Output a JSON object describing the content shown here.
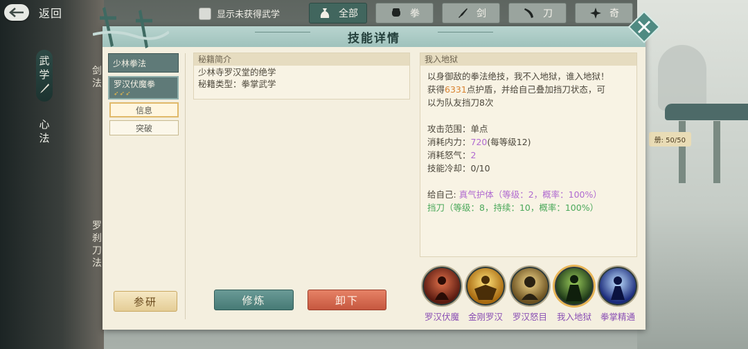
{
  "topbar": {
    "back_label": "返回",
    "show_unlearned_label": "显示未获得武学",
    "tabs": [
      {
        "label": "全部",
        "icon": "pouch-icon",
        "active": true
      },
      {
        "label": "拳",
        "icon": "fist-icon",
        "active": false
      },
      {
        "label": "剑",
        "icon": "sword-icon",
        "active": false
      },
      {
        "label": "刀",
        "icon": "blade-icon",
        "active": false
      },
      {
        "label": "奇",
        "icon": "shuriken-icon",
        "active": false
      }
    ]
  },
  "side_tabs": [
    {
      "label": "武学",
      "active": true
    },
    {
      "label": "心法",
      "active": false
    }
  ],
  "background": {
    "partial_labels": [
      "剑",
      "法",
      "罗",
      "刹",
      "刀",
      "法"
    ],
    "counter": "50/50"
  },
  "panel": {
    "title": "技能详情",
    "skill_list": [
      {
        "name": "少林拳法"
      },
      {
        "name": "罗汉伏魔拳",
        "stars": "3"
      }
    ],
    "sub_tabs": [
      "信息",
      "突破"
    ],
    "buttons": {
      "study": "参研",
      "train": "修炼",
      "unequip": "卸下"
    },
    "intro": {
      "title": "秘籍简介",
      "line1": "少林寺罗汉堂的绝学",
      "line2": "秘籍类型：拳掌武学"
    },
    "skill_desc": {
      "title": "我入地狱",
      "line1": "以身御敌的拳法绝技，我不入地狱，谁入地狱！",
      "line2_a": "获得",
      "line2_num": "6331",
      "line2_b": "点护盾，并给自己叠加挡刀状态，可",
      "line3": "以为队友挡刀8次",
      "range_label": "攻击范围：",
      "range_value": "单点",
      "mp_label": "消耗内力：",
      "mp_value": "720",
      "mp_extra": "(每等级12)",
      "rage_label": "消耗怒气：",
      "rage_value": "2",
      "cd_label": "技能冷却：",
      "cd_value": "0/10",
      "self_label": "给自己:",
      "self_value": "真气护体（等级：2，概率：100%）",
      "block_value": "挡刀（等级：8，持续：10，概率：100%）"
    },
    "skill_icons": [
      {
        "name": "罗汉伏魔",
        "color": "#7a2a1a"
      },
      {
        "name": "金刚罗汉",
        "color": "#c58a1c"
      },
      {
        "name": "罗汉怒目",
        "color": "#8c7030"
      },
      {
        "name": "我入地狱",
        "color": "#2d4a2a",
        "selected": true
      },
      {
        "name": "拳掌精通",
        "color": "#2a3c8a"
      }
    ]
  }
}
